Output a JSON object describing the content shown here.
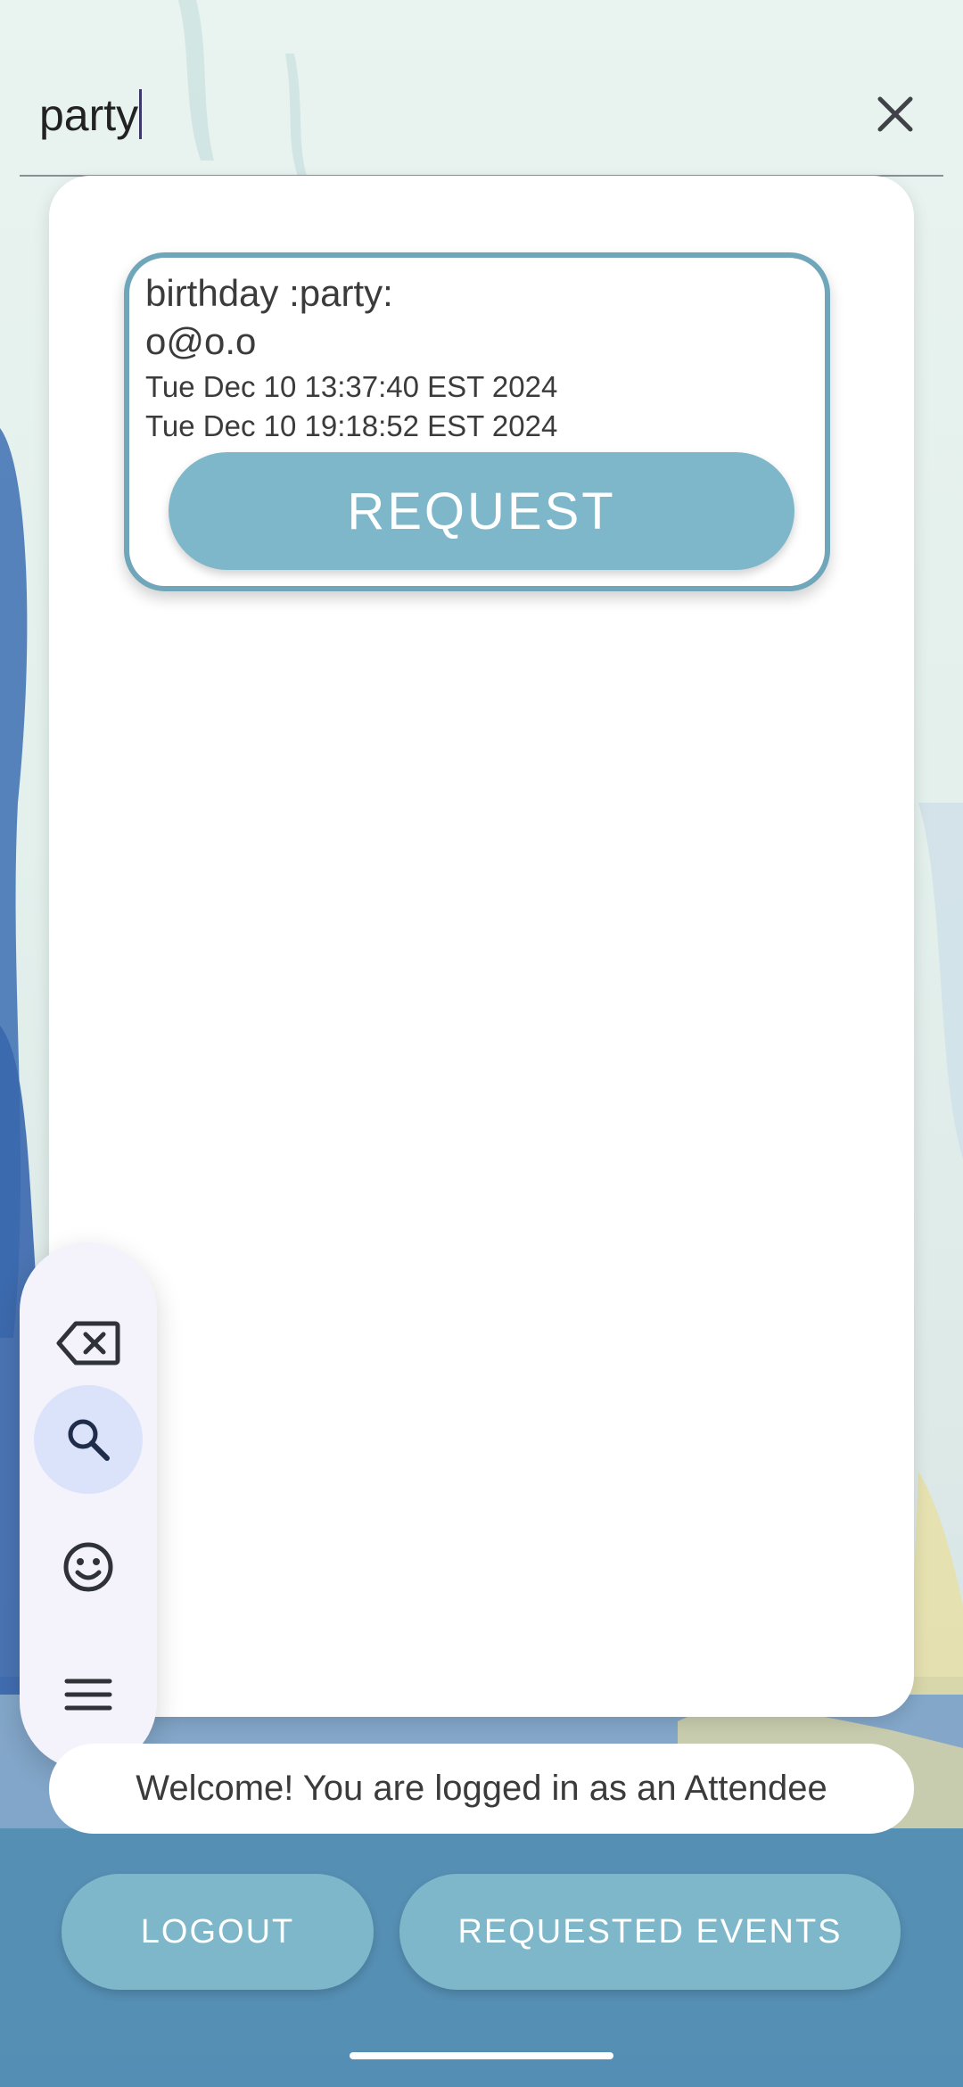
{
  "search": {
    "value": "party",
    "clear_icon": "close-icon"
  },
  "results": {
    "events": [
      {
        "title": "birthday :party:",
        "host": "o@o.o",
        "start": "Tue Dec 10 13:37:40 EST 2024",
        "end": "Tue Dec 10 19:18:52 EST 2024",
        "button_label": "REQUEST"
      }
    ]
  },
  "keyboard_toolbar": {
    "items": [
      {
        "icon": "backspace-icon"
      },
      {
        "icon": "search-icon",
        "active": true
      },
      {
        "icon": "emoji-icon"
      },
      {
        "icon": "menu-icon"
      }
    ]
  },
  "status": {
    "welcome": "Welcome! You are logged in as an Attendee"
  },
  "actions": {
    "logout": "LOGOUT",
    "requested_events": "REQUESTED EVENTS"
  },
  "colors": {
    "accent": "#7db7c9",
    "card_border": "#6fa6ba",
    "text": "#3b3b3b"
  }
}
